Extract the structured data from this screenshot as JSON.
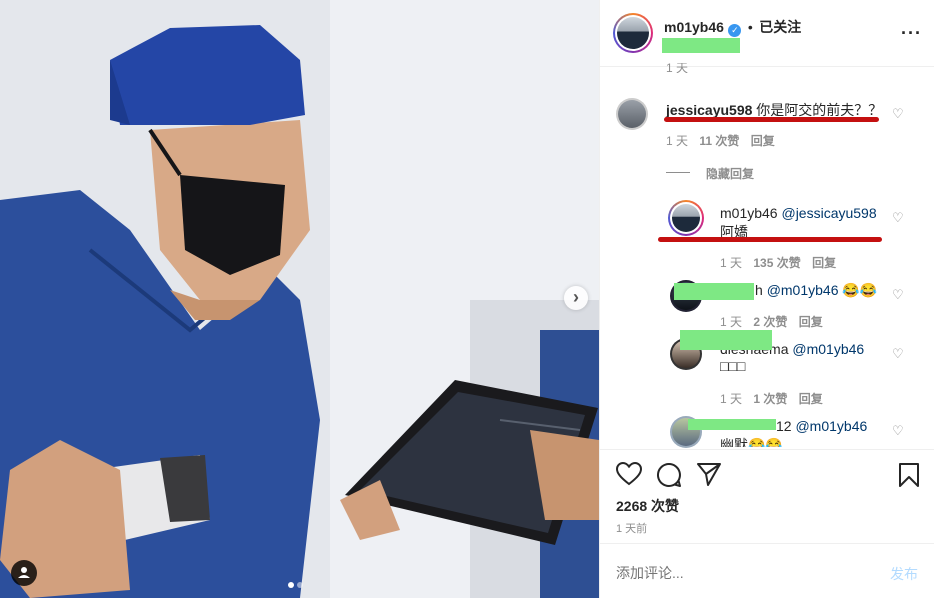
{
  "post": {
    "username": "m01yb46",
    "verified_icon": "verified-badge-icon",
    "separator": "•",
    "follow_status": "已关注",
    "more_icon": "more-options-icon",
    "photo_description_icon": "doctor-with-tablet-photo"
  },
  "comments": {
    "top_partial_time": "1 天",
    "c1": {
      "username": "jessicayu598",
      "text": "你是阿交的前夫？？",
      "time": "1 天",
      "likes": "11 次赞",
      "reply": "回复",
      "hide_replies": "隐藏回复"
    },
    "r1": {
      "username": "m01yb46",
      "mention": "@jessicayu598",
      "text": "阿嬌",
      "time": "1 天",
      "likes": "135 次赞",
      "reply": "回复"
    },
    "r2": {
      "username_tail": "h",
      "mention": "@m01yb46",
      "text": "😂😂",
      "time": "1 天",
      "likes": "2 次赞",
      "reply": "回复"
    },
    "r3": {
      "username": "dieshaema",
      "mention": "@m01yb46",
      "text": "□□□",
      "time": "1 天",
      "likes": "1 次赞",
      "reply": "回复"
    },
    "r4": {
      "username_tail": "12",
      "mention": "@m01yb46",
      "text": "幽默😂😂"
    }
  },
  "actions": {
    "likes_count": "2268 次赞",
    "posted_time": "1 天前"
  },
  "add_comment": {
    "placeholder": "添加评论...",
    "post_label": "发布"
  },
  "colors": {
    "accent": "#3897f0",
    "redact_green": "#7ee884",
    "underline_red": "#c41010"
  }
}
